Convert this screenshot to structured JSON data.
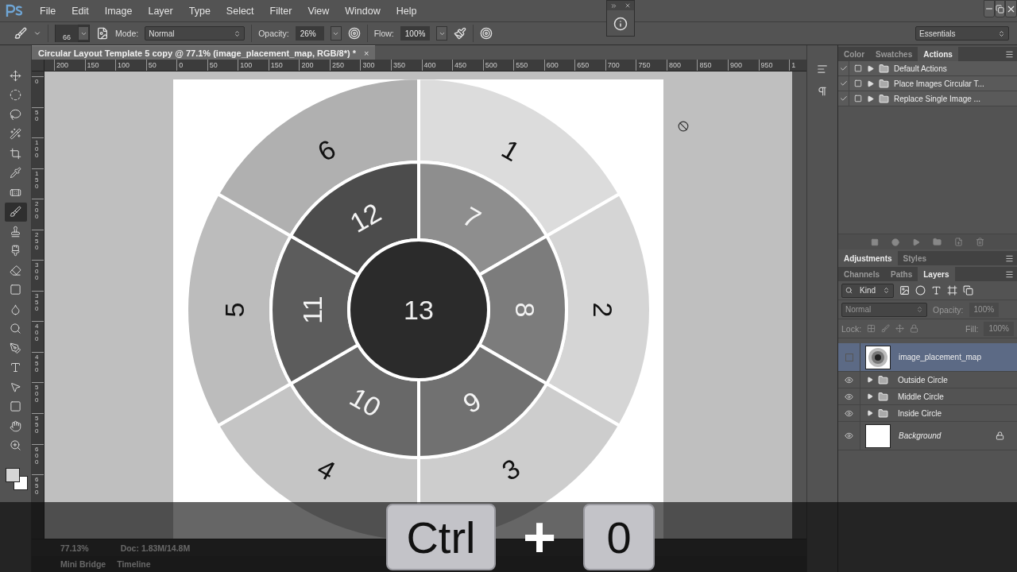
{
  "menu": [
    "File",
    "Edit",
    "Image",
    "Layer",
    "Type",
    "Select",
    "Filter",
    "View",
    "Window",
    "Help"
  ],
  "options": {
    "brush_size": "66",
    "mode_label": "Mode:",
    "mode": "Normal",
    "opacity_label": "Opacity:",
    "opacity": "26%",
    "flow_label": "Flow:",
    "flow": "100%",
    "workspace": "Essentials"
  },
  "document": {
    "title": "Circular Layout Template 5 copy @ 77.1% (image_placement_map, RGB/8*) *",
    "close": "×",
    "top_ruler": [
      "200",
      "150",
      "100",
      "50",
      "0",
      "50",
      "100",
      "150",
      "200",
      "250",
      "300",
      "350",
      "400",
      "450",
      "500",
      "550",
      "600",
      "650",
      "700",
      "750",
      "800",
      "850",
      "900",
      "950",
      "1"
    ],
    "left_ruler": [
      "0",
      "50",
      "100",
      "150",
      "200",
      "250",
      "300",
      "350",
      "400",
      "450",
      "500",
      "550",
      "600",
      "650"
    ],
    "outer_ring": [
      {
        "label": "1",
        "color": "#dcdcdc"
      },
      {
        "label": "2",
        "color": "#d5d5d5"
      },
      {
        "label": "3",
        "color": "#cdcdcd"
      },
      {
        "label": "4",
        "color": "#c5c5c5"
      },
      {
        "label": "5",
        "color": "#bcbcbc"
      },
      {
        "label": "6",
        "color": "#b0b0b0"
      }
    ],
    "middle_ring": [
      {
        "label": "7",
        "color": "#8e8e8e"
      },
      {
        "label": "8",
        "color": "#7c7c7c"
      },
      {
        "label": "9",
        "color": "#717171"
      },
      {
        "label": "10",
        "color": "#686868"
      },
      {
        "label": "11",
        "color": "#5c5c5c"
      },
      {
        "label": "12",
        "color": "#4c4c4c"
      }
    ],
    "center": {
      "label": "13",
      "color": "#2b2b2b"
    }
  },
  "tools": [
    {
      "selected": false
    },
    {
      "selected": false
    },
    {
      "selected": false
    },
    {
      "selected": false
    },
    {
      "selected": false
    },
    {
      "selected": false
    },
    {
      "selected": false
    },
    {
      "selected": true
    },
    {
      "selected": false
    },
    {
      "selected": false
    },
    {
      "selected": false
    },
    {
      "selected": false
    },
    {
      "selected": false
    },
    {
      "selected": false
    },
    {
      "selected": false
    },
    {
      "selected": false
    },
    {
      "selected": false
    },
    {
      "selected": false
    },
    {
      "selected": false
    },
    {
      "selected": false
    }
  ],
  "status_bar": {
    "zoom": "77.13%",
    "doc": "Doc: 1.83M/14.8M",
    "tabs": [
      "Mini Bridge",
      "Timeline"
    ]
  },
  "actions_panel": {
    "tabs": [
      {
        "label": "Color",
        "selected": false
      },
      {
        "label": "Swatches",
        "selected": false
      },
      {
        "label": "Actions",
        "selected": true
      }
    ],
    "items": [
      {
        "name": "Default Actions",
        "checked": true
      },
      {
        "name": "Place Images Circular T...",
        "checked": true
      },
      {
        "name": "Replace Single Image ...",
        "checked": true
      }
    ]
  },
  "adjustments_panel": {
    "tabs": [
      {
        "label": "Adjustments",
        "selected": true
      },
      {
        "label": "Styles",
        "selected": false
      }
    ]
  },
  "layers_panel": {
    "tabs": [
      {
        "label": "Channels",
        "selected": false
      },
      {
        "label": "Paths",
        "selected": false
      },
      {
        "label": "Layers",
        "selected": true
      }
    ],
    "filter": "Kind",
    "blend_mode": "Normal",
    "opacity_label": "Opacity:",
    "opacity": "100%",
    "lock_label": "Lock:",
    "fill_label": "Fill:",
    "fill": "100%",
    "layers": [
      {
        "name": "image_placement_map",
        "kind": "image",
        "visible": false,
        "selected": true
      },
      {
        "name": "Outside Circle",
        "kind": "group",
        "visible": true,
        "selected": false
      },
      {
        "name": "Middle Circle",
        "kind": "group",
        "visible": true,
        "selected": false
      },
      {
        "name": "Inside Circle",
        "kind": "group",
        "visible": true,
        "selected": false
      },
      {
        "name": "Background",
        "kind": "background",
        "visible": true,
        "selected": false
      }
    ]
  },
  "shortcut": [
    {
      "kind": "key",
      "label": "Ctrl"
    },
    {
      "kind": "plus",
      "label": "+"
    },
    {
      "kind": "key",
      "label": "0"
    }
  ]
}
